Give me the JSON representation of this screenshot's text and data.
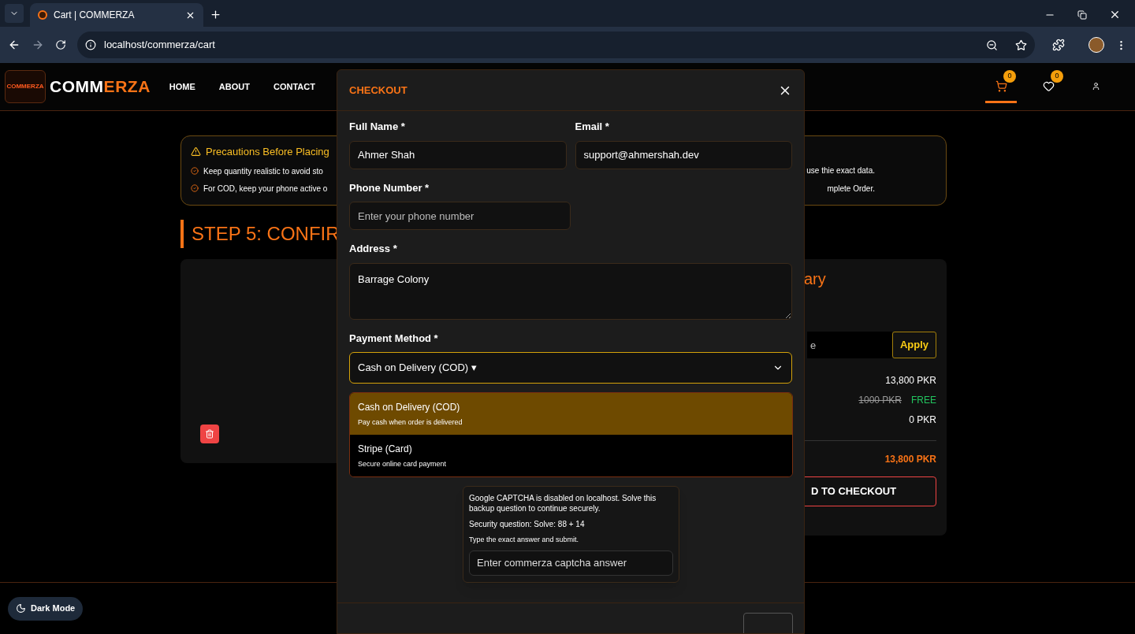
{
  "browser": {
    "tab_title": "Cart | COMMERZA",
    "url": "localhost/commerza/cart"
  },
  "navbar": {
    "logo_badge": "COMMERZA",
    "brand": {
      "part_1": "COMM",
      "part_2": "ERZA"
    },
    "links": [
      {
        "label": "HOME"
      },
      {
        "label": "ABOUT"
      },
      {
        "label": "CONTACT"
      }
    ],
    "icons": [
      {
        "kind": "cart",
        "count": "0",
        "selected": true
      },
      {
        "kind": "wishlist",
        "count": "0",
        "selected": false
      },
      {
        "kind": "account",
        "selected": false
      }
    ]
  },
  "precautions": {
    "title": "Precautions Before Placing",
    "items": [
      {
        "start": "Keep quantity realistic to avoid sto",
        "end": "use thie exact data."
      },
      {
        "start": "For COD, keep your phone active o",
        "end": "mplete Order."
      }
    ]
  },
  "step_heading": "STEP 5: CONFIR",
  "summary": {
    "heading": "ary",
    "coupon_placeholder": "e",
    "apply": "Apply",
    "rows": [
      {
        "value": "13,800 PKR"
      },
      {
        "old_value": "1000 PKR",
        "value": "FREE"
      },
      {
        "value": "0 PKR"
      }
    ],
    "total": "13,800 PKR",
    "checkout": "D TO CHECKOUT"
  },
  "modal": {
    "title": "CHECKOUT",
    "fields": [
      {
        "label": "Full Name *",
        "value": "Ahmer Shah"
      },
      {
        "label": "Email *",
        "value": "support@ahmershah.dev"
      },
      {
        "label": "Phone Number *",
        "placeholder": "Enter your phone number"
      },
      {
        "label": "Address *",
        "value": "Barrage Colony"
      }
    ],
    "payment": {
      "label": "Payment Method *",
      "value": "Cash on Delivery (COD) ▾",
      "options": [
        {
          "title": "Cash on Delivery (COD)",
          "subtitle": "Pay cash when order is delivered",
          "selected": true
        },
        {
          "title": "Stripe (Card)",
          "subtitle": "Secure online card payment",
          "selected": false
        }
      ]
    },
    "captcha": {
      "notice": "Google CAPTCHA is disabled on localhost. Solve this backup question to continue securely.",
      "question": "Security question: Solve: 88 + 14",
      "hint": "Type the exact answer and submit.",
      "placeholder": "Enter commerza captcha answer"
    }
  },
  "dark_mode": "Dark Mode"
}
